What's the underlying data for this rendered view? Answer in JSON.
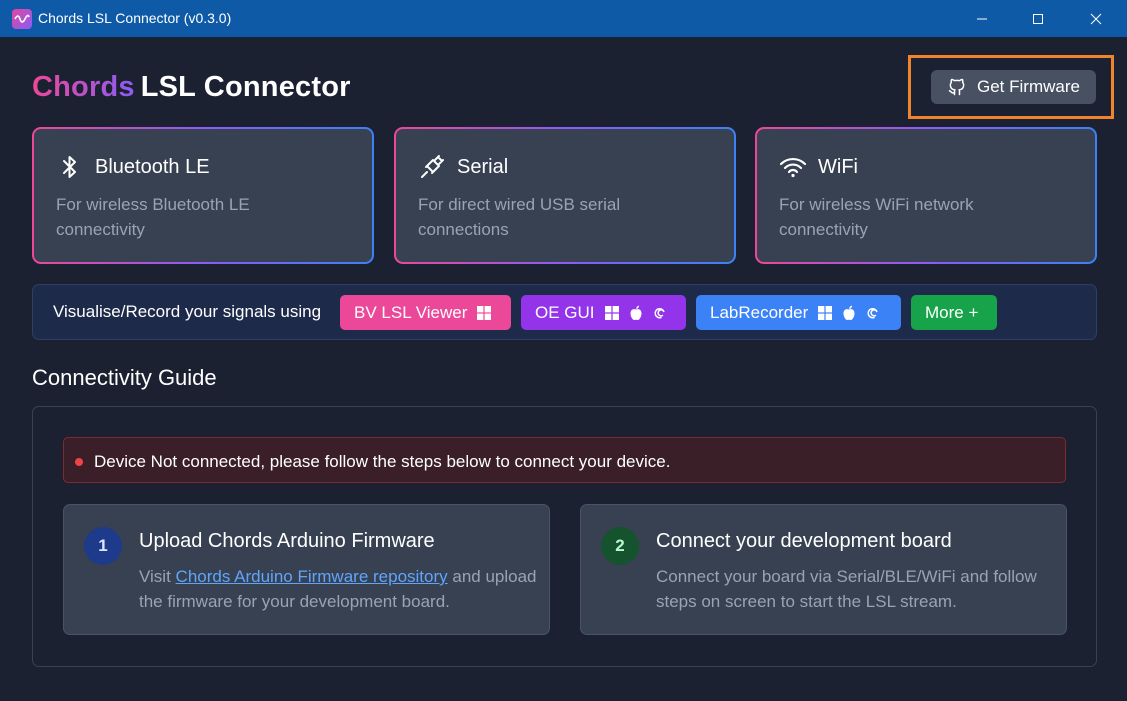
{
  "window": {
    "title": "Chords LSL Connector (v0.3.0)"
  },
  "brand": {
    "part1": "Chords",
    "part2": "LSL Connector"
  },
  "firmware_button": {
    "label": "Get Firmware",
    "icon": "github-icon"
  },
  "connections": [
    {
      "icon": "bluetooth-icon",
      "title": "Bluetooth LE",
      "description": "For wireless Bluetooth LE connectivity"
    },
    {
      "icon": "serial-plug-icon",
      "title": "Serial",
      "description": "For direct wired USB serial connections"
    },
    {
      "icon": "wifi-icon",
      "title": "WiFi",
      "description": "For wireless WiFi network connectivity"
    }
  ],
  "visualise": {
    "label": "Visualise/Record your signals using",
    "apps": [
      {
        "label": "BV LSL Viewer",
        "platforms": [
          "windows"
        ],
        "color": "#ec4899"
      },
      {
        "label": "OE GUI",
        "platforms": [
          "windows",
          "apple",
          "debian"
        ],
        "color": "#9333ea"
      },
      {
        "label": "LabRecorder",
        "platforms": [
          "windows",
          "apple",
          "debian"
        ],
        "color": "#3b82f6"
      },
      {
        "label": "More +",
        "platforms": [],
        "color": "#16a34a"
      }
    ]
  },
  "guide": {
    "title": "Connectivity Guide",
    "alert": "Device Not connected, please follow the steps below to connect your device.",
    "steps": [
      {
        "number": "1",
        "title": "Upload Chords Arduino Firmware",
        "desc_before": "Visit ",
        "link": "Chords Arduino Firmware repository",
        "desc_after": " and upload the firmware for your development board."
      },
      {
        "number": "2",
        "title": "Connect your development board",
        "desc": "Connect your board via Serial/BLE/WiFi and follow steps on screen to start the LSL stream."
      }
    ]
  },
  "colors": {
    "titlebar": "#0e5aa7",
    "background": "#1b2130",
    "card": "#374151",
    "highlight": "#f0842c"
  }
}
